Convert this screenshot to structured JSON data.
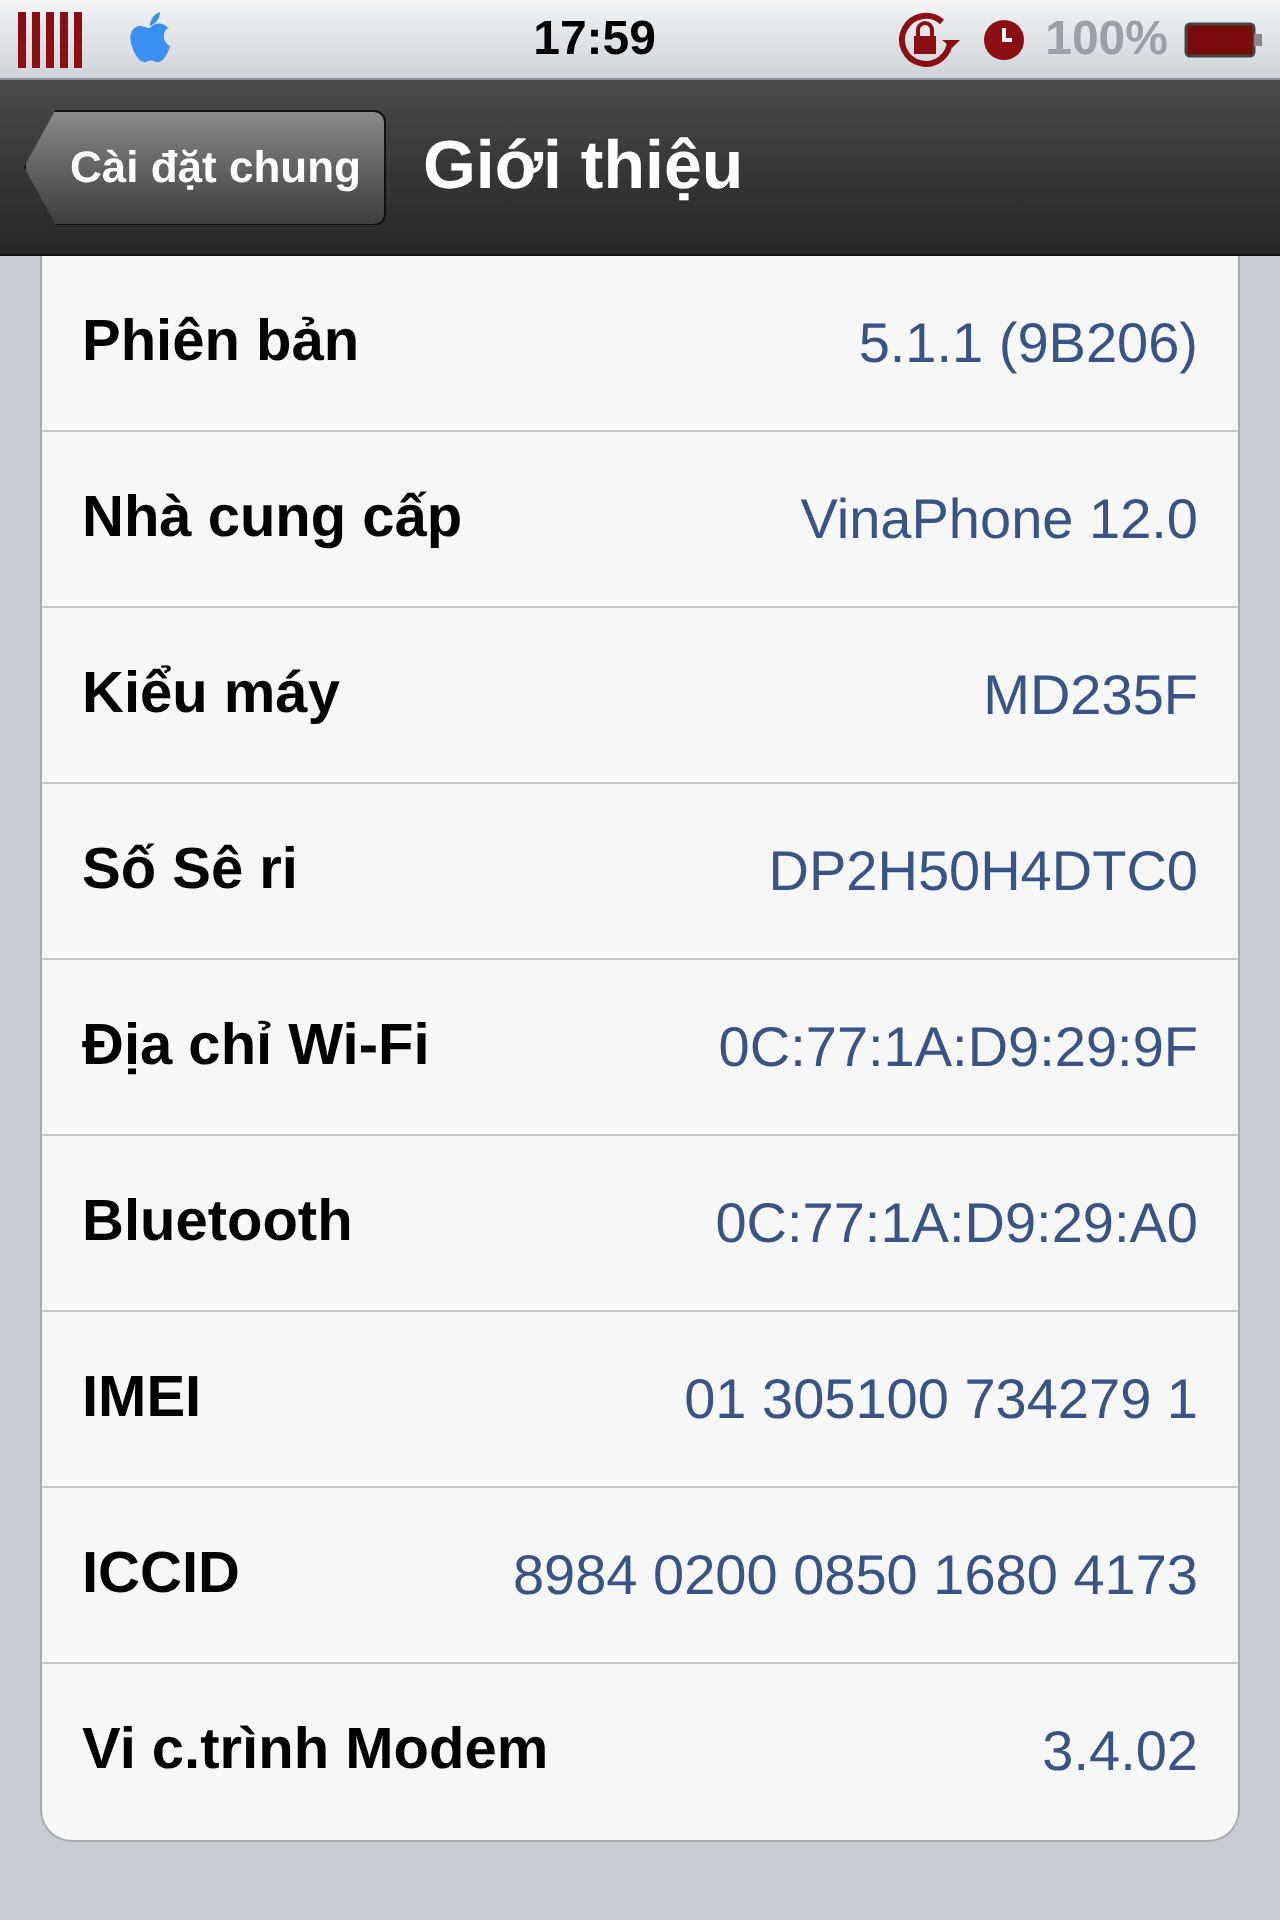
{
  "status_bar": {
    "time": "17:59",
    "battery_percent": "100%"
  },
  "nav_bar": {
    "back_button": "Cài đặt chung",
    "title": "Giới thiệu"
  },
  "rows": [
    {
      "label": "Phiên bản",
      "value": "5.1.1 (9B206)"
    },
    {
      "label": "Nhà cung cấp",
      "value": "VinaPhone 12.0"
    },
    {
      "label": "Kiểu máy",
      "value": "MD235F"
    },
    {
      "label": "Số Sê ri",
      "value": "DP2H50H4DTC0"
    },
    {
      "label": "Địa chỉ Wi-Fi",
      "value": "0C:77:1A:D9:29:9F"
    },
    {
      "label": "Bluetooth",
      "value": "0C:77:1A:D9:29:A0"
    },
    {
      "label": "IMEI",
      "value": "01 305100 734279 1"
    },
    {
      "label": "ICCID",
      "value": "8984 0200 0850 1680 4173"
    },
    {
      "label": "Vi c.trình Modem",
      "value": "3.4.02"
    }
  ]
}
